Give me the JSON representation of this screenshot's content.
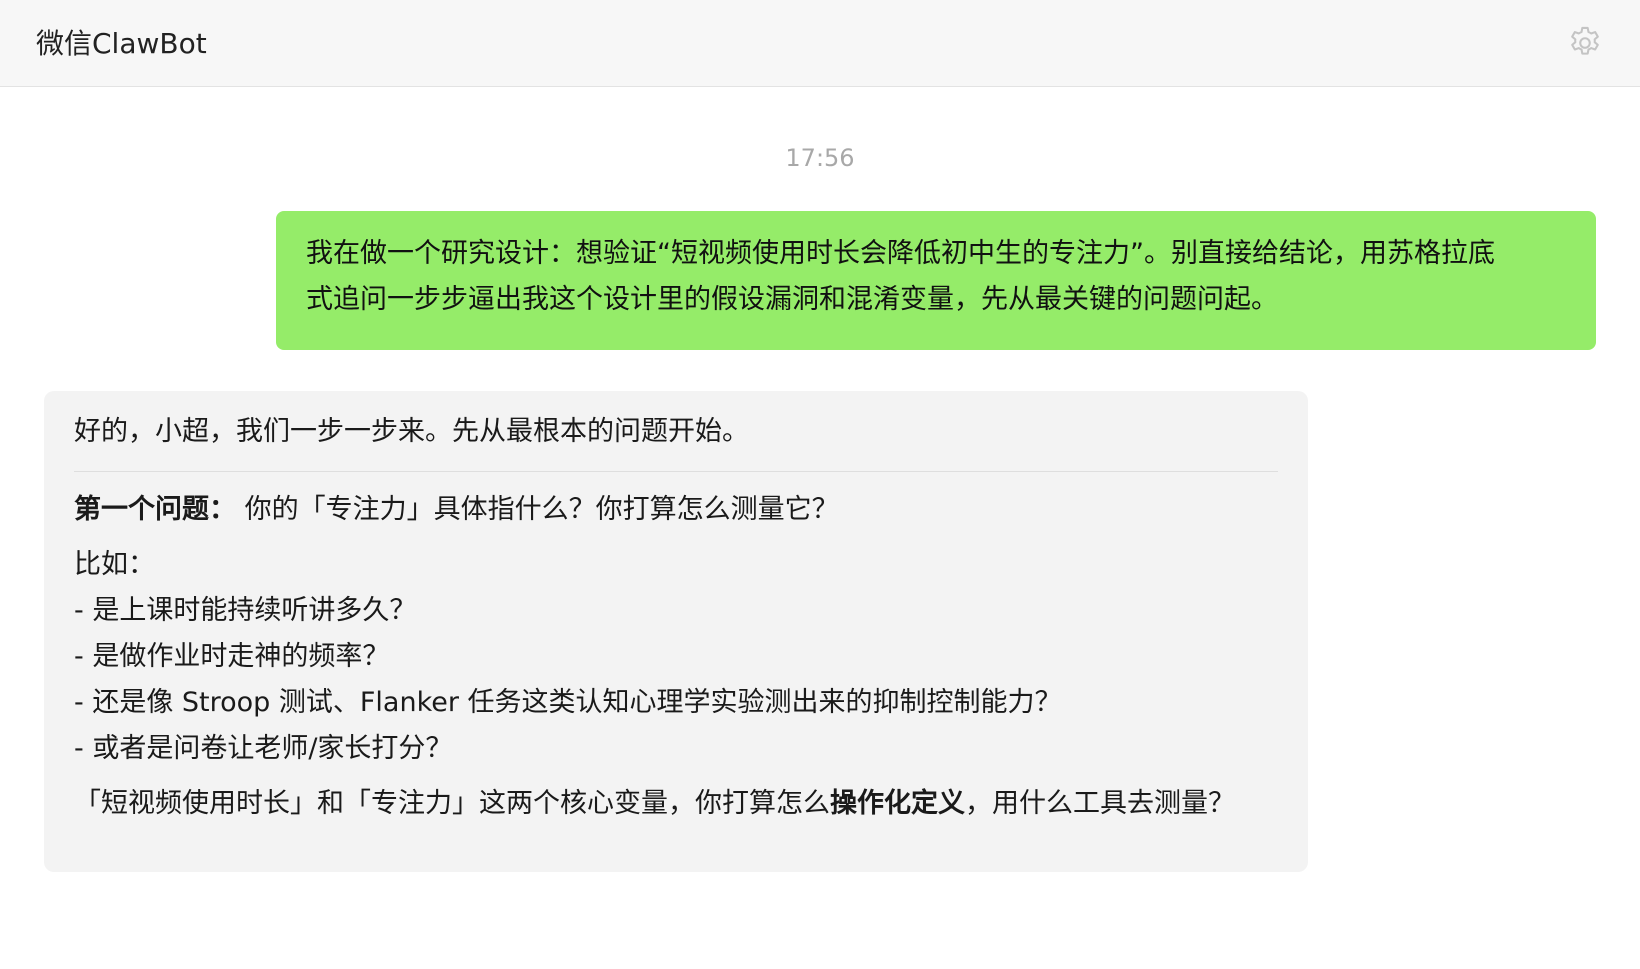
{
  "header": {
    "title": "微信ClawBot",
    "settings_icon": "gear-icon"
  },
  "chat": {
    "timestamp": "17:56",
    "user_message": {
      "line1": "我在做一个研究设计：想验证“短视频使用时长会降低初中生的专注力”。别直接给结论，用苏格拉底",
      "line2": "式追问一步步逼出我这个设计里的假设漏洞和混淆变量，先从最关键的问题问起。",
      "bubble_color": "#95ec69"
    },
    "bot_message": {
      "greeting": "好的，小超，我们一步一步来。先从最根本的问题开始。",
      "question_label": "第一个问题：",
      "question_text": " 你的「专注力」具体指什么？你打算怎么测量它？",
      "example_intro": "比如：",
      "examples": [
        "- 是上课时能持续听讲多久？",
        "- 是做作业时走神的频率？",
        "- 还是像 Stroop 测试、Flanker 任务这类认知心理学实验测出来的抑制控制能力？",
        "- 或者是问卷让老师/家长打分？"
      ],
      "final_prefix": "「短视频使用时长」和「专注力」这两个核心变量，你打算怎么",
      "final_bold": "操作化定义",
      "final_suffix": "，用什么工具去测量？",
      "bubble_color": "#f3f3f3"
    }
  }
}
